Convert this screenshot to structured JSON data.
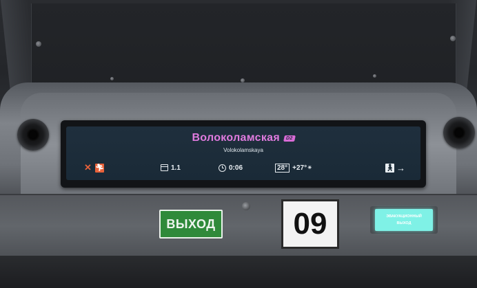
{
  "display": {
    "station_name": "Волоколамская",
    "line_badge": "D2",
    "station_latin": "Volokolamskaya",
    "closed_mark": "✕",
    "car_number": "1.1",
    "time": "0:06",
    "temp_inside": "28°",
    "temp_outside": "+27°",
    "exit_arrow": "→"
  },
  "signs": {
    "exit": "ВЫХОД",
    "door_number": "09",
    "emergency_line1": "ЭВАКУАЦИОННЫЙ",
    "emergency_line2": "ВЫХОД"
  },
  "colors": {
    "station_name": "#e07bdf",
    "exit_sign_bg": "#2f8a3a",
    "emergency_sign_bg": "#7ff1e6",
    "closed_side": "#e8623a"
  }
}
